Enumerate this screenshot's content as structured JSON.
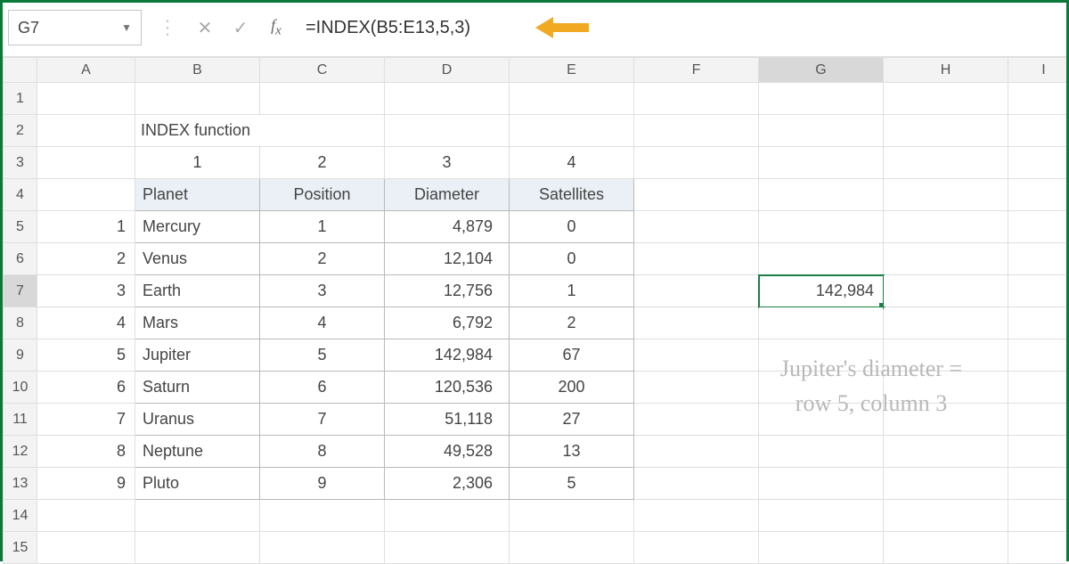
{
  "namebox": {
    "value": "G7"
  },
  "formula": "=INDEX(B5:E13,5,3)",
  "columns": [
    "A",
    "B",
    "C",
    "D",
    "E",
    "F",
    "G",
    "H",
    "I"
  ],
  "rows": [
    "1",
    "2",
    "3",
    "4",
    "5",
    "6",
    "7",
    "8",
    "9",
    "10",
    "11",
    "12",
    "13",
    "14",
    "15"
  ],
  "selected_col": "G",
  "selected_row": "7",
  "title": "INDEX function",
  "col_markers": [
    "1",
    "2",
    "3",
    "4"
  ],
  "row_markers": [
    "1",
    "2",
    "3",
    "4",
    "5",
    "6",
    "7",
    "8",
    "9"
  ],
  "headers": {
    "planet": "Planet",
    "position": "Position",
    "diameter": "Diameter",
    "satellites": "Satellites"
  },
  "planets": [
    {
      "name": "Mercury",
      "position": "1",
      "diameter": "4,879",
      "satellites": "0"
    },
    {
      "name": "Venus",
      "position": "2",
      "diameter": "12,104",
      "satellites": "0"
    },
    {
      "name": "Earth",
      "position": "3",
      "diameter": "12,756",
      "satellites": "1"
    },
    {
      "name": "Mars",
      "position": "4",
      "diameter": "6,792",
      "satellites": "2"
    },
    {
      "name": "Jupiter",
      "position": "5",
      "diameter": "142,984",
      "satellites": "67"
    },
    {
      "name": "Saturn",
      "position": "6",
      "diameter": "120,536",
      "satellites": "200"
    },
    {
      "name": "Uranus",
      "position": "7",
      "diameter": "51,118",
      "satellites": "27"
    },
    {
      "name": "Neptune",
      "position": "8",
      "diameter": "49,528",
      "satellites": "13"
    },
    {
      "name": "Pluto",
      "position": "9",
      "diameter": "2,306",
      "satellites": "5"
    }
  ],
  "result": "142,984",
  "annotation": {
    "line1": "Jupiter's diameter =",
    "line2": "row 5, column 3"
  }
}
